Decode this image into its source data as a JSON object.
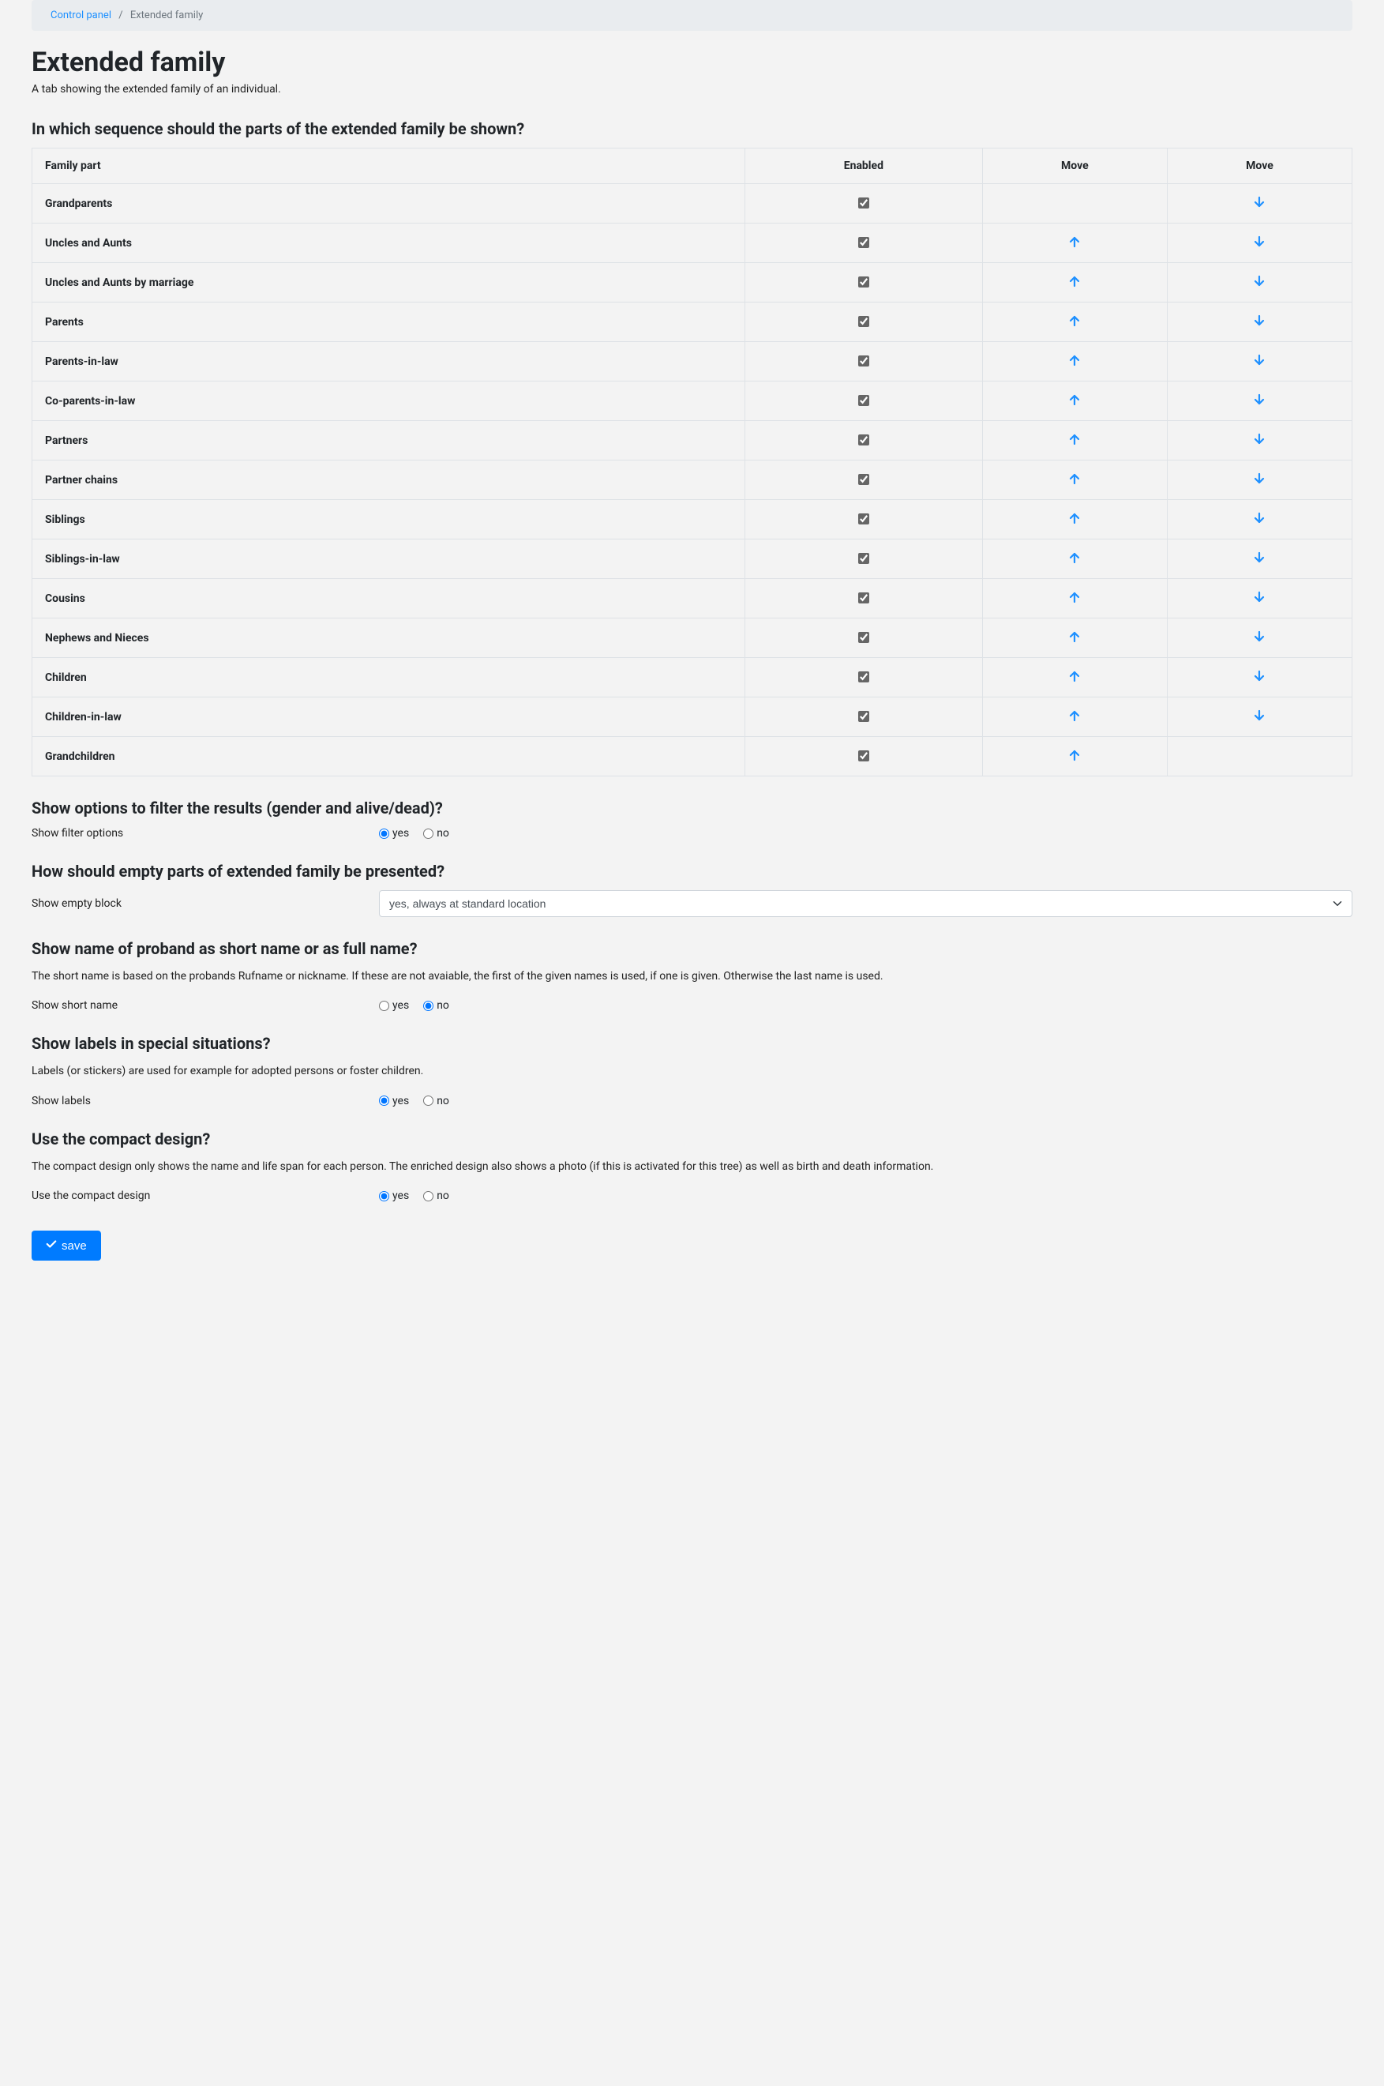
{
  "breadcrumb": {
    "root": "Control panel",
    "current": "Extended family"
  },
  "page": {
    "title": "Extended family",
    "subtitle": "A tab showing the extended family of an individual."
  },
  "sequence": {
    "heading": "In which sequence should the parts of the extended family be shown?",
    "columns": {
      "name": "Family part",
      "enabled": "Enabled",
      "move1": "Move",
      "move2": "Move"
    },
    "rows": [
      {
        "label": "Grandparents",
        "enabled": true,
        "up": false,
        "down": true
      },
      {
        "label": "Uncles and Aunts",
        "enabled": true,
        "up": true,
        "down": true
      },
      {
        "label": "Uncles and Aunts by marriage",
        "enabled": true,
        "up": true,
        "down": true
      },
      {
        "label": "Parents",
        "enabled": true,
        "up": true,
        "down": true
      },
      {
        "label": "Parents-in-law",
        "enabled": true,
        "up": true,
        "down": true
      },
      {
        "label": "Co-parents-in-law",
        "enabled": true,
        "up": true,
        "down": true
      },
      {
        "label": "Partners",
        "enabled": true,
        "up": true,
        "down": true
      },
      {
        "label": "Partner chains",
        "enabled": true,
        "up": true,
        "down": true
      },
      {
        "label": "Siblings",
        "enabled": true,
        "up": true,
        "down": true
      },
      {
        "label": "Siblings-in-law",
        "enabled": true,
        "up": true,
        "down": true
      },
      {
        "label": "Cousins",
        "enabled": true,
        "up": true,
        "down": true
      },
      {
        "label": "Nephews and Nieces",
        "enabled": true,
        "up": true,
        "down": true
      },
      {
        "label": "Children",
        "enabled": true,
        "up": true,
        "down": true
      },
      {
        "label": "Children-in-law",
        "enabled": true,
        "up": true,
        "down": true
      },
      {
        "label": "Grandchildren",
        "enabled": true,
        "up": true,
        "down": false
      }
    ]
  },
  "filter": {
    "heading": "Show options to filter the results (gender and alive/dead)?",
    "label": "Show filter options",
    "yes": "yes",
    "no": "no",
    "value": "yes"
  },
  "empty": {
    "heading": "How should empty parts of extended family be presented?",
    "label": "Show empty block",
    "value": "yes, always at standard location"
  },
  "shortname": {
    "heading": "Show name of proband as short name or as full name?",
    "desc": "The short name is based on the probands Rufname or nickname. If these are not avaiable, the first of the given names is used, if one is given. Otherwise the last name is used.",
    "label": "Show short name",
    "yes": "yes",
    "no": "no",
    "value": "no"
  },
  "labels": {
    "heading": "Show labels in special situations?",
    "desc": "Labels (or stickers) are used for example for adopted persons or foster children.",
    "label": "Show labels",
    "yes": "yes",
    "no": "no",
    "value": "yes"
  },
  "compact": {
    "heading": "Use the compact design?",
    "desc": "The compact design only shows the name and life span for each person. The enriched design also shows a photo (if this is activated for this tree) as well as birth and death information.",
    "label": "Use the compact design",
    "yes": "yes",
    "no": "no",
    "value": "yes"
  },
  "save": "save"
}
